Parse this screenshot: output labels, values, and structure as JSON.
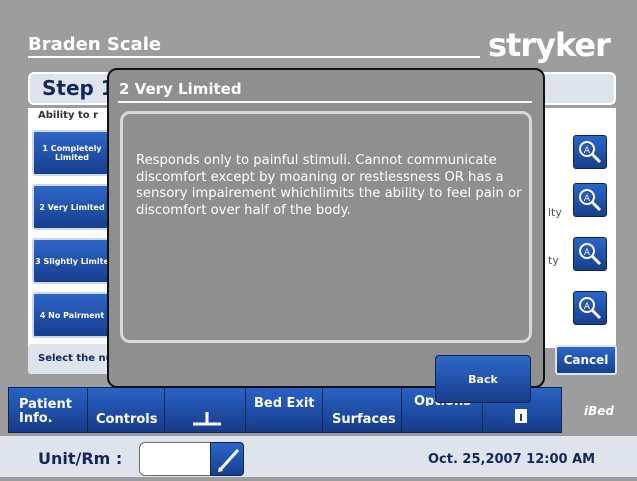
{
  "header": {
    "title": "Braden Scale",
    "brand": "stryker"
  },
  "step": {
    "label": "Step 1",
    "subheader": "Ability to r"
  },
  "options": [
    {
      "label": "1 Completely Limited"
    },
    {
      "label": "2 Very Limited"
    },
    {
      "label": "3 Slightly Limite"
    },
    {
      "label": "4 No Pairment"
    }
  ],
  "background_text": {
    "row2": "ity",
    "row3": "ty"
  },
  "footer": {
    "hint": "Select the nu",
    "cancel_label": "Cancel"
  },
  "nav": {
    "patient_info": "Patient Info.",
    "controls": "Controls",
    "bed_exit": "Bed Exit",
    "surfaces": "Surfaces",
    "options": "Options",
    "ibed": "iBed"
  },
  "bottom": {
    "unit_label": "Unit/Rm :",
    "unit_value": "",
    "datetime": "Oct. 25,2007  12:00 AM"
  },
  "modal": {
    "title": "2 Very Limited",
    "body": "Responds only to painful stimuli. Cannot communicate discomfort except by moaning or restlessness  OR has a sensory impairement whichlimits the ability to feel pain or discomfort over half of the body.",
    "back_label": "Back"
  },
  "colors": {
    "accent": "#1f4fa8",
    "navy_text": "#14275a",
    "background": "#9d9d9d"
  }
}
